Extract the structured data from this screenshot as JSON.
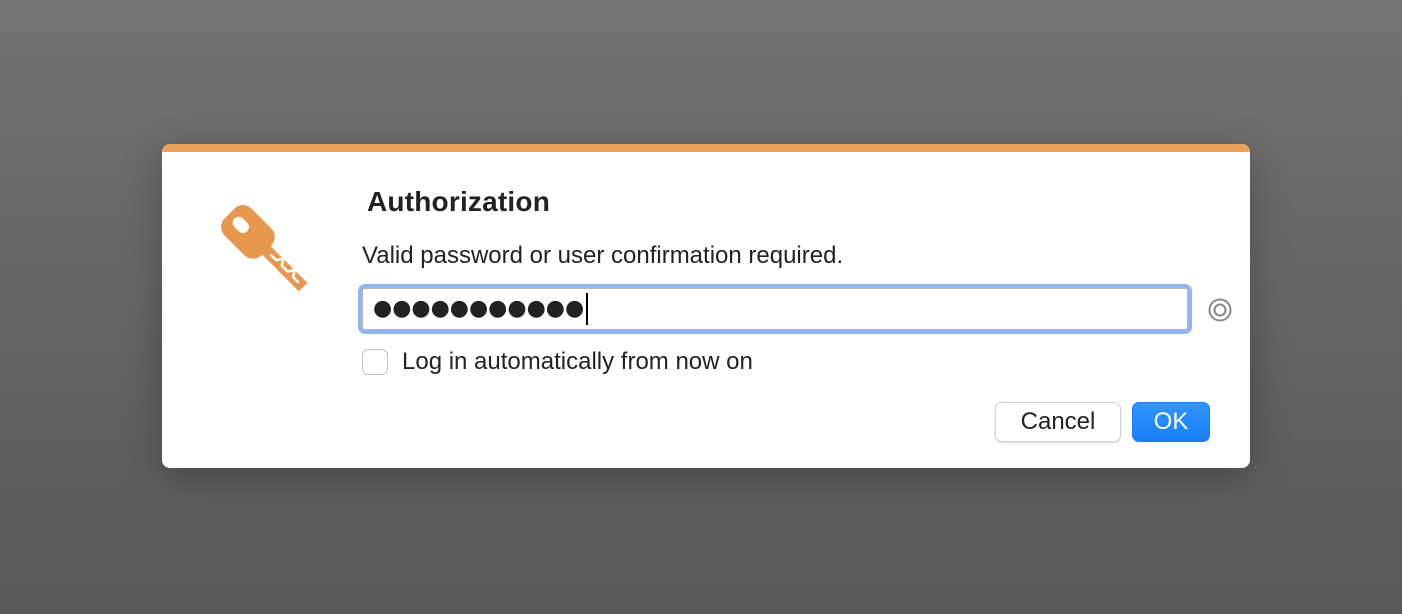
{
  "dialog": {
    "title": "Authorization",
    "message": "Valid password or user confirmation required.",
    "icon": "key-icon",
    "accent_color": "#eaa25a",
    "password": {
      "masked_value": "●●●●●●●●●●●",
      "reveal_icon": "eye-reveal-icon"
    },
    "auto_login": {
      "label": "Log in automatically from now on",
      "checked": false
    },
    "buttons": {
      "cancel_label": "Cancel",
      "ok_label": "OK",
      "ok_color": "#1a7ff5"
    }
  }
}
